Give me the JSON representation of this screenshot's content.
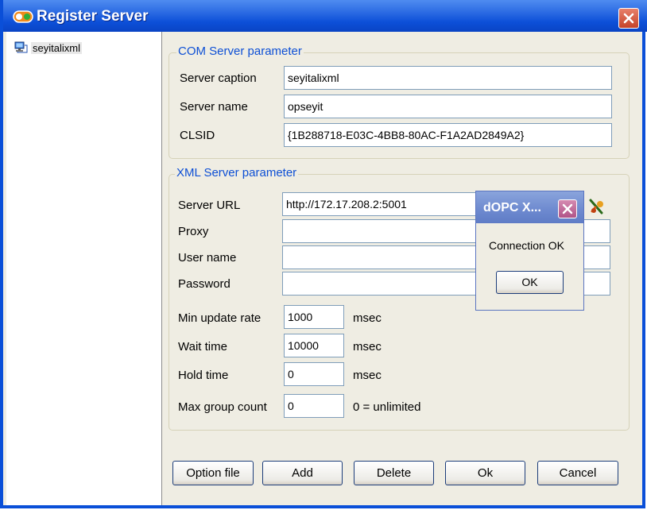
{
  "window": {
    "title": "Register Server"
  },
  "tree": {
    "items": [
      {
        "label": "seyitalixml",
        "icon": "computer-network-icon"
      }
    ]
  },
  "com": {
    "legend": "COM Server parameter",
    "caption_label": "Server caption",
    "caption_value": "seyitalixml",
    "name_label": "Server name",
    "name_value": "opseyit",
    "clsid_label": "CLSID",
    "clsid_value": "{1B288718-E03C-4BB8-80AC-F1A2AD2849A2}"
  },
  "xml": {
    "legend": "XML Server parameter",
    "url_label": "Server URL",
    "url_value": "http://172.17.208.2:5001",
    "proxy_label": "Proxy",
    "proxy_value": "",
    "user_label": "User name",
    "user_value": "",
    "password_label": "Password",
    "password_value": "",
    "min_update_label": "Min update rate",
    "min_update_value": "1000",
    "min_update_unit": "msec",
    "wait_label": "Wait time",
    "wait_value": "10000",
    "wait_unit": "msec",
    "hold_label": "Hold time",
    "hold_value": "0",
    "hold_unit": "msec",
    "max_group_label": "Max group count",
    "max_group_value": "0",
    "max_group_note": "0 = unlimited"
  },
  "buttons": {
    "option_file": "Option file",
    "add": "Add",
    "delete": "Delete",
    "ok": "Ok",
    "cancel": "Cancel"
  },
  "dialog": {
    "title": "dOPC X...",
    "message": "Connection OK",
    "ok": "OK"
  },
  "colors": {
    "titlebar": "#0c4fd8",
    "legend_text": "#0d4fd5",
    "dialog_titlebar": "#6d89cf"
  }
}
